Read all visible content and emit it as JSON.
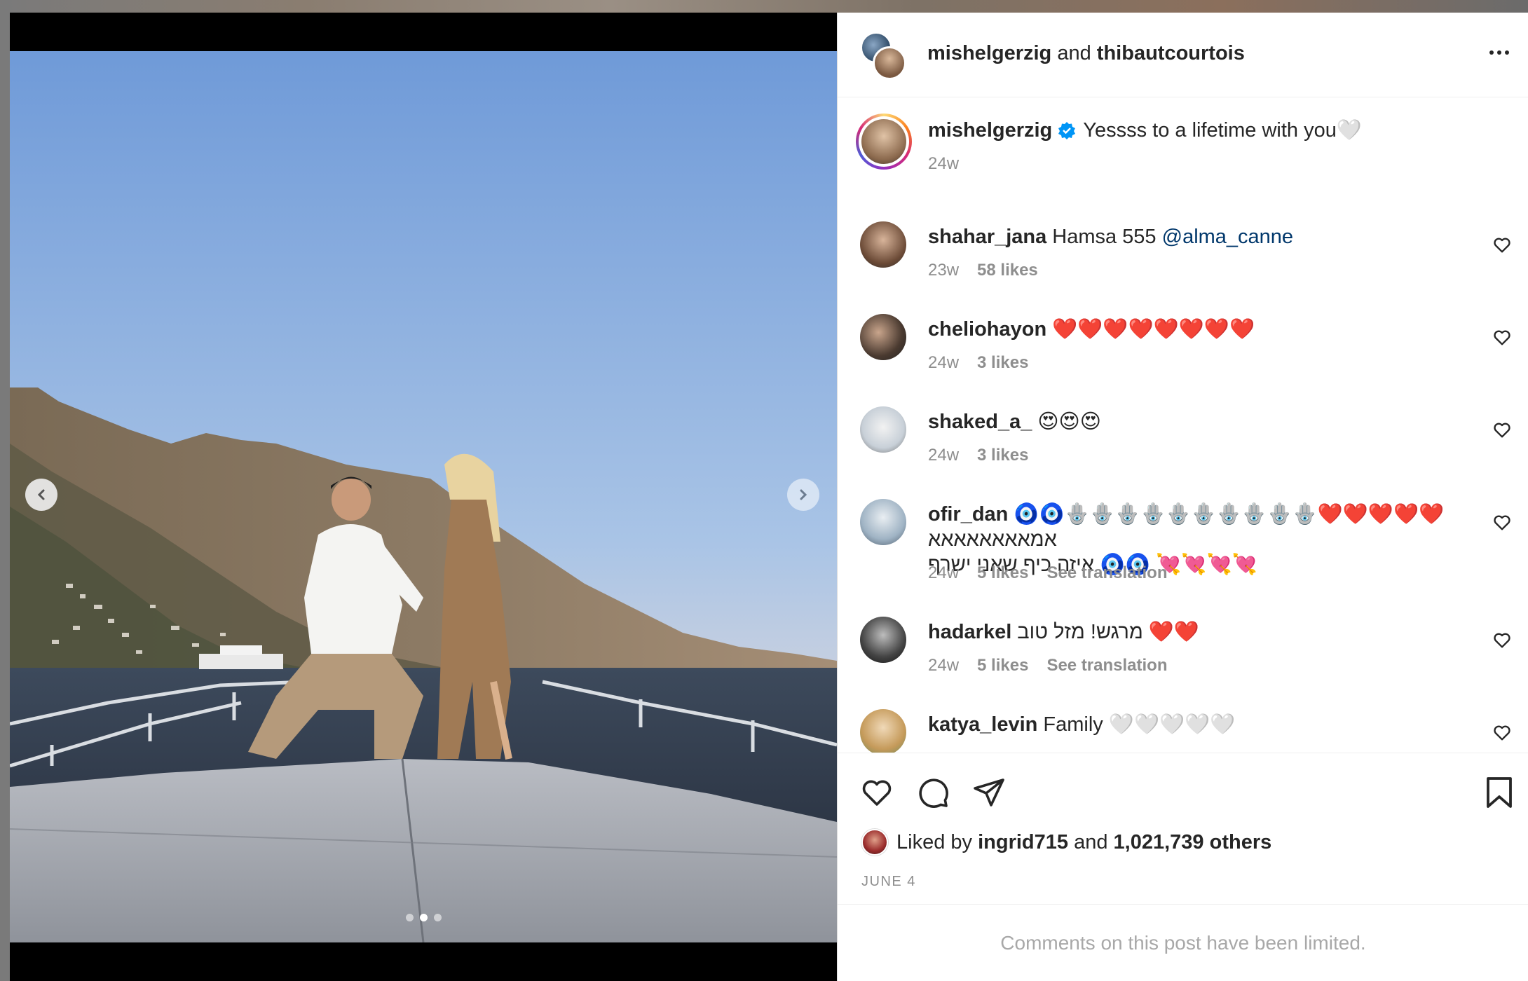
{
  "post": {
    "header": {
      "user1": "mishelgerzig",
      "conjunction": "and",
      "user2": "thibautcourtois"
    },
    "caption": {
      "username": "mishelgerzig",
      "verified": true,
      "text": "Yessss to a lifetime with you🤍",
      "time": "24w"
    },
    "carousel": {
      "current_index": 2,
      "total": 3
    },
    "comments": [
      {
        "username": "shahar_jana",
        "text": "Hamsa 555 ",
        "mention": "@alma_canne",
        "time": "23w",
        "likes": "58 likes"
      },
      {
        "username": "cheliohayon",
        "text": "❤️❤️❤️❤️❤️❤️❤️❤️",
        "time": "24w",
        "likes": "3 likes"
      },
      {
        "username": "shaked_a_",
        "text": "😍😍😍",
        "time": "24w",
        "likes": "3 likes"
      },
      {
        "username": "ofir_dan",
        "text": "🧿🧿🪬🪬🪬🪬🪬🪬🪬🪬🪬🪬❤️❤️❤️❤️❤️ אמאאאאאאאא",
        "text2": "איזה כיף שאני ישרף 🧿🧿 💘💘💘💘",
        "time": "24w",
        "likes": "5 likes",
        "translation": "See translation"
      },
      {
        "username": "hadarkel",
        "text": "מרגש! מזל טוב ❤️❤️",
        "time": "24w",
        "likes": "5 likes",
        "translation": "See translation"
      },
      {
        "username": "katya_levin",
        "text": "Family 🤍🤍🤍🤍🤍"
      }
    ],
    "liked_by": {
      "prefix": "Liked by",
      "user": "ingrid715",
      "middle": "and",
      "count": "1,021,739 others"
    },
    "date": "JUNE 4",
    "comments_limited": "Comments on this post have been limited."
  },
  "colors": {
    "text": "#262626",
    "muted": "#8e8e8e",
    "mention": "#00376b",
    "verified": "#0095f6",
    "heart_red": "#ed1c24"
  },
  "icons": [
    "chevron-left-icon",
    "chevron-right-icon",
    "more-icon",
    "verified-icon",
    "heart-icon",
    "comment-icon",
    "share-icon",
    "bookmark-icon"
  ]
}
